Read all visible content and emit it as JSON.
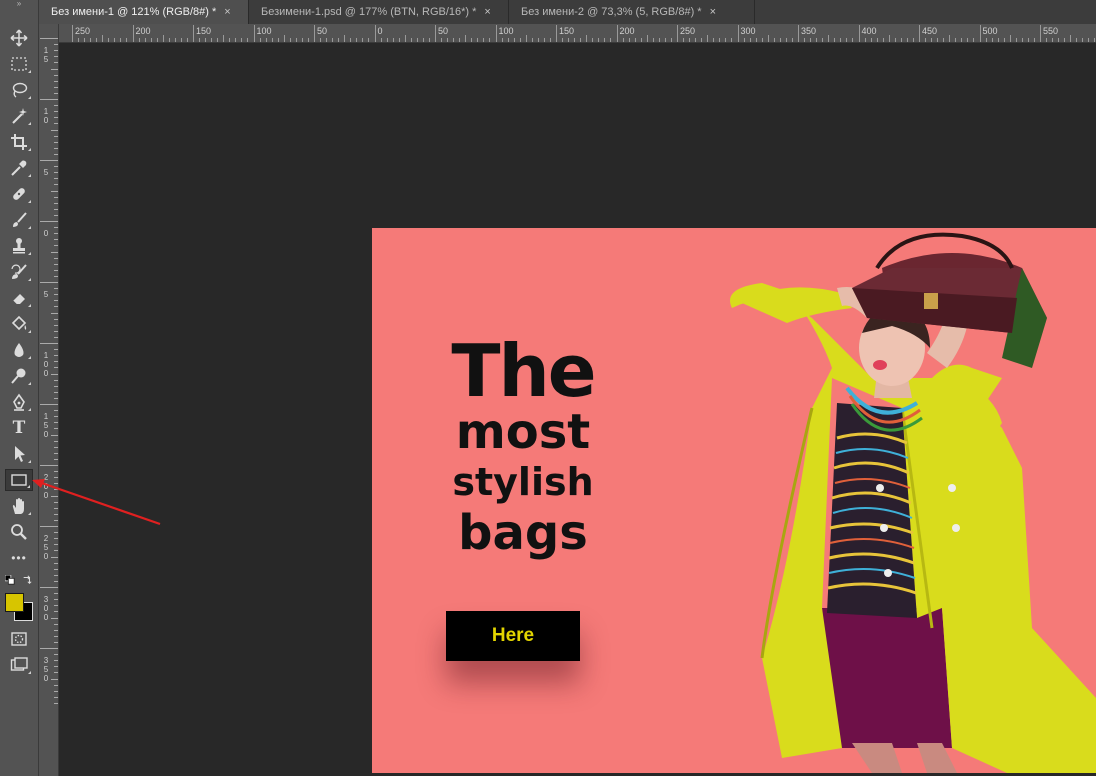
{
  "tabs": [
    {
      "label": "Без имени-1 @ 121% (RGB/8#) *",
      "close": "×",
      "active": true
    },
    {
      "label": "Безимени-1.psd @ 177% (BTN, RGB/16*) *",
      "close": "×",
      "active": false
    },
    {
      "label": "Без имени-2 @ 73,3% (5, RGB/8#) *",
      "close": "×",
      "active": false
    }
  ],
  "ruler_top": [
    "250",
    "200",
    "150",
    "100",
    "50",
    "0",
    "50",
    "100",
    "150",
    "200",
    "250",
    "300",
    "350",
    "400",
    "450",
    "500",
    "550"
  ],
  "ruler_left": [
    {
      "digits": "1 5"
    },
    {
      "digits": "1 0"
    },
    {
      "digits": "5"
    },
    {
      "digits": "0"
    },
    {
      "digits": "5"
    },
    {
      "digits": "1 0 0"
    },
    {
      "digits": "1 5 0"
    },
    {
      "digits": "2 0 0"
    },
    {
      "digits": "2 5 0"
    },
    {
      "digits": "3 0 0"
    },
    {
      "digits": "3 5 0"
    }
  ],
  "tools": [
    "move-tool",
    "marquee-tool",
    "lasso-tool",
    "magic-wand-tool",
    "crop-tool",
    "eyedropper-tool",
    "healing-brush-tool",
    "brush-tool",
    "clone-stamp-tool",
    "history-brush-tool",
    "eraser-tool",
    "paint-bucket-tool",
    "blur-tool",
    "dodge-tool",
    "pen-tool",
    "type-tool",
    "path-selection-tool",
    "rectangle-tool",
    "hand-tool",
    "zoom-tool",
    "edit-toolbar-tool"
  ],
  "type_tool_glyph": "T",
  "more_glyph": "•••",
  "colors": {
    "foreground": "#d7c500",
    "background": "#000000",
    "canvas": "#f57a78",
    "button_text": "#e2d400",
    "arrow": "#e02020"
  },
  "canvas": {
    "headline": {
      "line1": "The",
      "line2": "most",
      "line3": "stylish",
      "line4": "bags"
    },
    "button_label": "Here"
  }
}
